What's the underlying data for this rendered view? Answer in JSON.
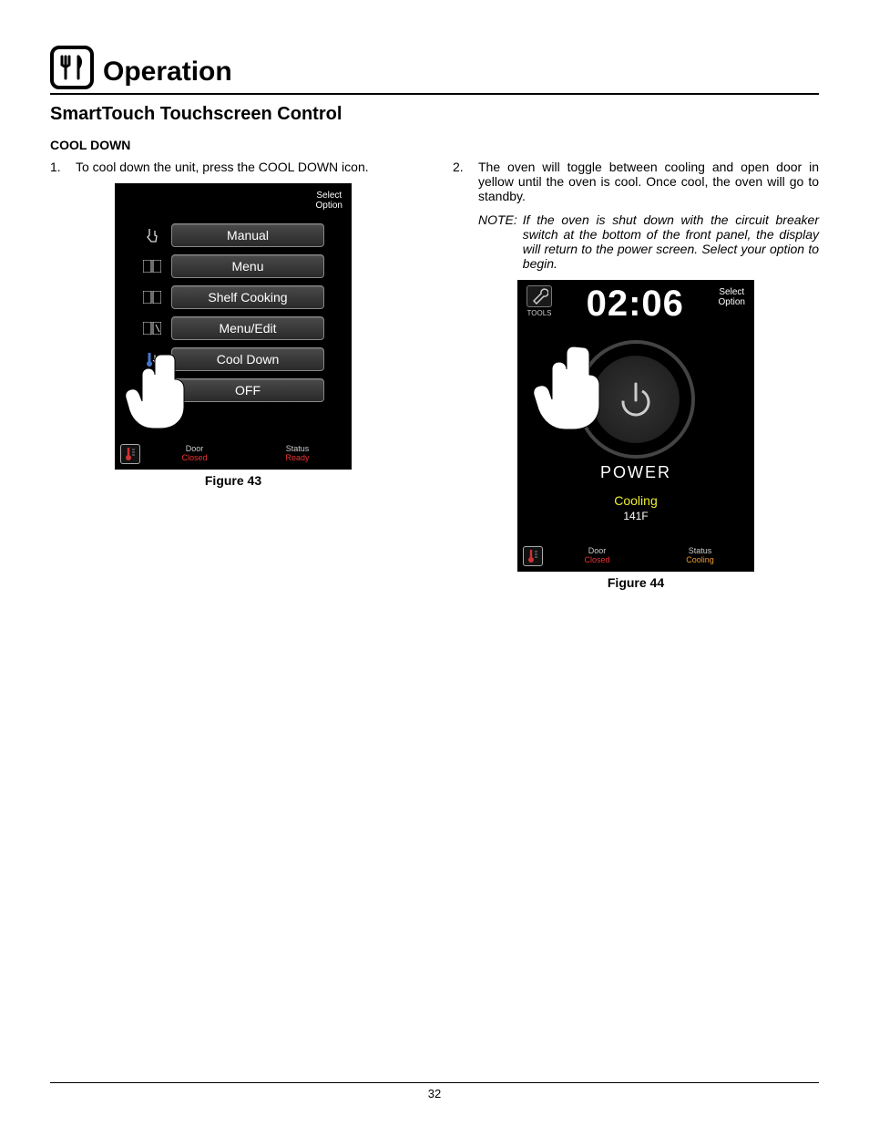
{
  "header": {
    "title": "Operation",
    "subtitle": "SmartTouch Touchscreen Control"
  },
  "section": {
    "heading": "COOL DOWN",
    "steps": [
      {
        "num": "1.",
        "text": "To cool down the unit, press the COOL DOWN icon."
      },
      {
        "num": "2.",
        "text": "The oven will toggle between cooling and open door in yellow until the oven is cool. Once cool, the oven will go to standby."
      }
    ],
    "note": {
      "label": "NOTE:",
      "text": "If the oven is shut down with the circuit breaker switch at the bottom of the front panel, the display will return to the power screen. Select your option to begin."
    }
  },
  "figures": {
    "fig43": {
      "caption": "Figure 43"
    },
    "fig44": {
      "caption": "Figure 44"
    }
  },
  "screen1": {
    "select_option_line1": "Select",
    "select_option_line2": "Option",
    "menu_items": [
      "Manual",
      "Menu",
      "Shelf  Cooking",
      "Menu/Edit",
      "Cool  Down",
      "OFF"
    ],
    "status": {
      "door_label": "Door",
      "door_value": "Closed",
      "status_label": "Status",
      "status_value": "Ready"
    }
  },
  "screen2": {
    "tools_label": "TOOLS",
    "time": "02:06",
    "select_option_line1": "Select",
    "select_option_line2": "Option",
    "power_label": "POWER",
    "cooling_label": "Cooling",
    "temp": "141F",
    "status": {
      "door_label": "Door",
      "door_value": "Closed",
      "status_label": "Status",
      "status_value": "Cooling"
    }
  },
  "page_number": "32"
}
